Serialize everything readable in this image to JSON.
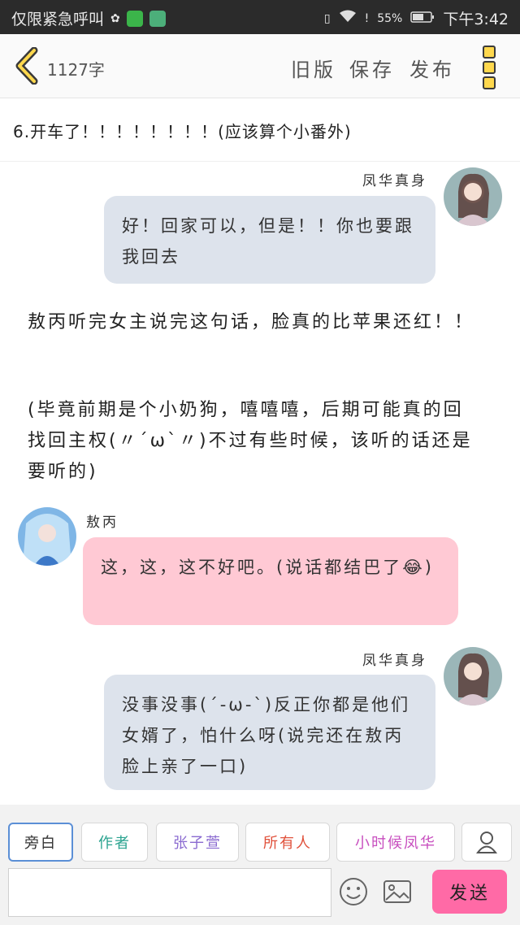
{
  "status_bar": {
    "carrier": "仅限紧急呼叫",
    "battery": "55%",
    "time": "下午3:42"
  },
  "header": {
    "word_count": "1127字",
    "old_version_label": "旧版",
    "save_label": "保存",
    "publish_label": "发布"
  },
  "chapter_title": "6.开车了！！！！！！！！(应该算个小番外)",
  "messages": [
    {
      "speaker": "凤华真身",
      "text": "好！回家可以，但是！！你也要跟我回去"
    },
    {
      "narration": "敖丙听完女主说完这句话，脸真的比苹果还红！！"
    },
    {
      "narration": "(毕竟前期是个小奶狗，嘻嘻嘻，后期可能真的回找回主权(〃´ω`〃)不过有些时候，该听的话还是要听的)"
    },
    {
      "speaker": "敖丙",
      "text": "这，这，这不好吧。(说话都结巴了😂)"
    },
    {
      "speaker": "凤华真身",
      "text": "没事没事(´-ω-`)反正你都是他们女婿了，怕什么呀(说完还在敖丙脸上亲了一口)"
    }
  ],
  "roles": [
    {
      "label": "旁白",
      "color": "#333333"
    },
    {
      "label": "作者",
      "color": "#2aa38f"
    },
    {
      "label": "张子萱",
      "color": "#8a6ad0"
    },
    {
      "label": "所有人",
      "color": "#e0503a"
    },
    {
      "label": "小时候凤华",
      "color": "#c84fbf"
    }
  ],
  "composer": {
    "input_value": "",
    "send_label": "发送"
  },
  "colors": {
    "bubble_female": "#dde3ec",
    "bubble_male": "#ffc9d4",
    "send_button": "#ff6aa6",
    "accent_yellow": "#ffd84d"
  }
}
